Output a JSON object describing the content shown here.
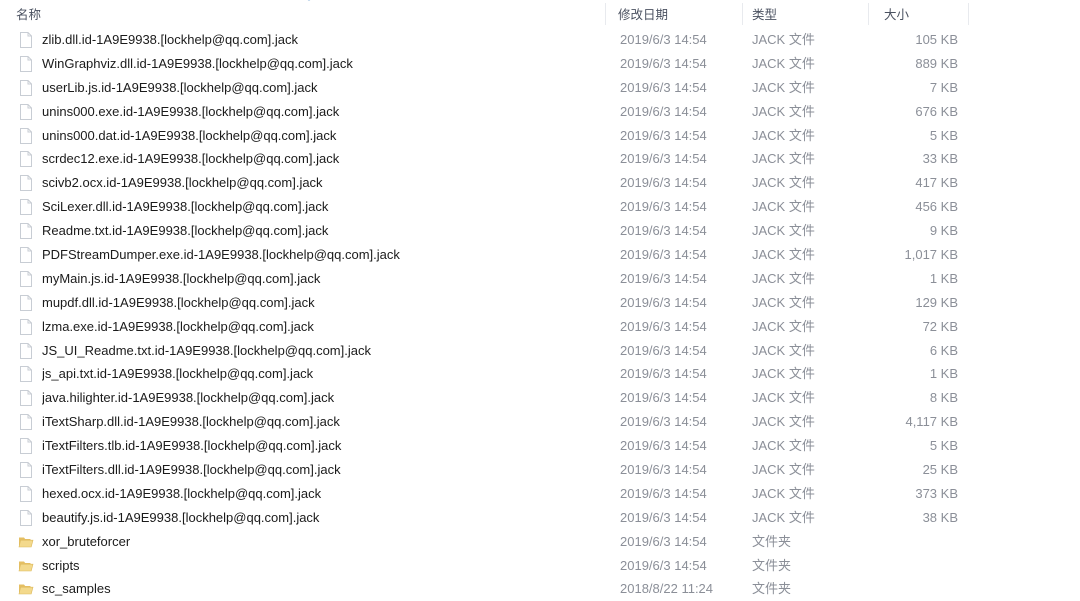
{
  "header": {
    "columns": [
      {
        "key": "name",
        "label": "名称"
      },
      {
        "key": "date",
        "label": "修改日期"
      },
      {
        "key": "type",
        "label": "类型"
      },
      {
        "key": "size",
        "label": "大小"
      }
    ],
    "sort": {
      "column": "名称",
      "direction": "ascending",
      "indicator_icon": "sort-ascending-triangle-icon",
      "indicator_color": "#a9c7e4"
    }
  },
  "colors": {
    "background": "#ffffff",
    "header_text": "#4a5160",
    "name_text": "#1b1b1b",
    "meta_text": "#8b8f98",
    "divider": "#e8eaee",
    "folder_icon": "#e8c56a",
    "file_icon_outline": "#c8cdd4"
  },
  "rows": [
    {
      "icon": "file-icon",
      "name": "zlib.dll.id-1A9E9938.[lockhelp@qq.com].jack",
      "date": "2019/6/3 14:54",
      "type": "JACK 文件",
      "size": "105 KB"
    },
    {
      "icon": "file-icon",
      "name": "WinGraphviz.dll.id-1A9E9938.[lockhelp@qq.com].jack",
      "date": "2019/6/3 14:54",
      "type": "JACK 文件",
      "size": "889 KB"
    },
    {
      "icon": "file-icon",
      "name": "userLib.js.id-1A9E9938.[lockhelp@qq.com].jack",
      "date": "2019/6/3 14:54",
      "type": "JACK 文件",
      "size": "7 KB"
    },
    {
      "icon": "file-icon",
      "name": "unins000.exe.id-1A9E9938.[lockhelp@qq.com].jack",
      "date": "2019/6/3 14:54",
      "type": "JACK 文件",
      "size": "676 KB"
    },
    {
      "icon": "file-icon",
      "name": "unins000.dat.id-1A9E9938.[lockhelp@qq.com].jack",
      "date": "2019/6/3 14:54",
      "type": "JACK 文件",
      "size": "5 KB"
    },
    {
      "icon": "file-icon",
      "name": "scrdec12.exe.id-1A9E9938.[lockhelp@qq.com].jack",
      "date": "2019/6/3 14:54",
      "type": "JACK 文件",
      "size": "33 KB"
    },
    {
      "icon": "file-icon",
      "name": "scivb2.ocx.id-1A9E9938.[lockhelp@qq.com].jack",
      "date": "2019/6/3 14:54",
      "type": "JACK 文件",
      "size": "417 KB"
    },
    {
      "icon": "file-icon",
      "name": "SciLexer.dll.id-1A9E9938.[lockhelp@qq.com].jack",
      "date": "2019/6/3 14:54",
      "type": "JACK 文件",
      "size": "456 KB"
    },
    {
      "icon": "file-icon",
      "name": "Readme.txt.id-1A9E9938.[lockhelp@qq.com].jack",
      "date": "2019/6/3 14:54",
      "type": "JACK 文件",
      "size": "9 KB"
    },
    {
      "icon": "file-icon",
      "name": "PDFStreamDumper.exe.id-1A9E9938.[lockhelp@qq.com].jack",
      "date": "2019/6/3 14:54",
      "type": "JACK 文件",
      "size": "1,017 KB"
    },
    {
      "icon": "file-icon",
      "name": "myMain.js.id-1A9E9938.[lockhelp@qq.com].jack",
      "date": "2019/6/3 14:54",
      "type": "JACK 文件",
      "size": "1 KB"
    },
    {
      "icon": "file-icon",
      "name": "mupdf.dll.id-1A9E9938.[lockhelp@qq.com].jack",
      "date": "2019/6/3 14:54",
      "type": "JACK 文件",
      "size": "129 KB"
    },
    {
      "icon": "file-icon",
      "name": "lzma.exe.id-1A9E9938.[lockhelp@qq.com].jack",
      "date": "2019/6/3 14:54",
      "type": "JACK 文件",
      "size": "72 KB"
    },
    {
      "icon": "file-icon",
      "name": "JS_UI_Readme.txt.id-1A9E9938.[lockhelp@qq.com].jack",
      "date": "2019/6/3 14:54",
      "type": "JACK 文件",
      "size": "6 KB"
    },
    {
      "icon": "file-icon",
      "name": "js_api.txt.id-1A9E9938.[lockhelp@qq.com].jack",
      "date": "2019/6/3 14:54",
      "type": "JACK 文件",
      "size": "1 KB"
    },
    {
      "icon": "file-icon",
      "name": "java.hilighter.id-1A9E9938.[lockhelp@qq.com].jack",
      "date": "2019/6/3 14:54",
      "type": "JACK 文件",
      "size": "8 KB"
    },
    {
      "icon": "file-icon",
      "name": "iTextSharp.dll.id-1A9E9938.[lockhelp@qq.com].jack",
      "date": "2019/6/3 14:54",
      "type": "JACK 文件",
      "size": "4,117 KB"
    },
    {
      "icon": "file-icon",
      "name": "iTextFilters.tlb.id-1A9E9938.[lockhelp@qq.com].jack",
      "date": "2019/6/3 14:54",
      "type": "JACK 文件",
      "size": "5 KB"
    },
    {
      "icon": "file-icon",
      "name": "iTextFilters.dll.id-1A9E9938.[lockhelp@qq.com].jack",
      "date": "2019/6/3 14:54",
      "type": "JACK 文件",
      "size": "25 KB"
    },
    {
      "icon": "file-icon",
      "name": "hexed.ocx.id-1A9E9938.[lockhelp@qq.com].jack",
      "date": "2019/6/3 14:54",
      "type": "JACK 文件",
      "size": "373 KB"
    },
    {
      "icon": "file-icon",
      "name": "beautify.js.id-1A9E9938.[lockhelp@qq.com].jack",
      "date": "2019/6/3 14:54",
      "type": "JACK 文件",
      "size": "38 KB"
    },
    {
      "icon": "folder-icon",
      "name": "xor_bruteforcer",
      "date": "2019/6/3 14:54",
      "type": "文件夹",
      "size": ""
    },
    {
      "icon": "folder-icon",
      "name": "scripts",
      "date": "2019/6/3 14:54",
      "type": "文件夹",
      "size": ""
    },
    {
      "icon": "folder-icon",
      "name": "sc_samples",
      "date": "2018/8/22 11:24",
      "type": "文件夹",
      "size": ""
    }
  ]
}
